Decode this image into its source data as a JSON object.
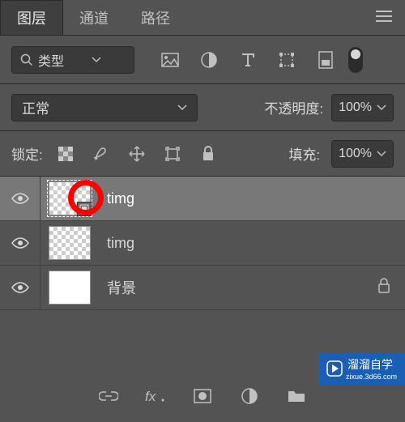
{
  "tabs": {
    "layers": "图层",
    "channels": "通道",
    "paths": "路径"
  },
  "filter": {
    "type_label": "类型"
  },
  "blend": {
    "mode": "正常",
    "opacity_label": "不透明度:",
    "opacity_value": "100%"
  },
  "lock": {
    "label": "锁定:",
    "fill_label": "填充:",
    "fill_value": "100%"
  },
  "layers": [
    {
      "name": "timg",
      "selected": true,
      "checker": true,
      "smart": true,
      "locked": false
    },
    {
      "name": "timg",
      "selected": false,
      "checker": true,
      "smart": false,
      "locked": false
    },
    {
      "name": "背景",
      "selected": false,
      "checker": false,
      "smart": false,
      "locked": true
    }
  ],
  "watermark": {
    "brand": "溜溜自学",
    "url": "zixue.3d66.com"
  }
}
